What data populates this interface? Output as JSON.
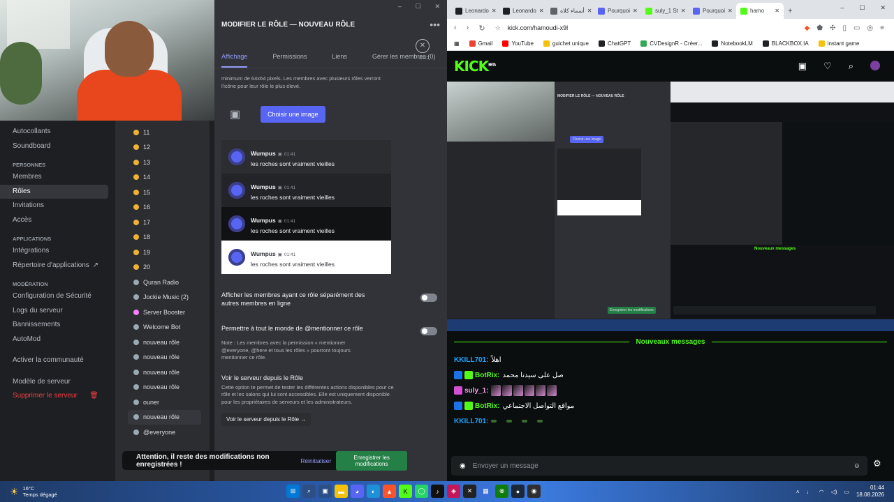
{
  "discord": {
    "window_controls": [
      "–",
      "☐",
      "✕"
    ],
    "editor": {
      "title": "MODIFIER LE RÔLE — NOUVEAU RÔLE",
      "more_label": "•••",
      "tabs": [
        "Affichage",
        "Permissions",
        "Liens",
        "Gérer les membres (0)"
      ],
      "close_label": "✕",
      "esc_label": "ESC",
      "icon_hint": "minimum de 64x64 pixels. Les membres avec plusieurs rôles verront l'icône pour leur rôle le plus élevé.",
      "choose_image": "Choisir une image",
      "previews": [
        {
          "name": "Wumpus",
          "time": "01:41",
          "text": "les roches sont vraiment vieilles"
        },
        {
          "name": "Wumpus",
          "time": "01:41",
          "text": "les roches sont vraiment vieilles"
        },
        {
          "name": "Wumpus",
          "time": "01:41",
          "text": "les roches sont vraiment vieilles"
        },
        {
          "name": "Wumpus",
          "time": "01:41",
          "text": "les roches sont vraiment vieilles"
        }
      ],
      "setting_separate": "Afficher les membres ayant ce rôle séparément des autres membres en ligne",
      "setting_mention": "Permettre à tout le monde de @mentionner ce rôle",
      "mention_note": "Note : Les membres avec la permission « mentionner @everyone, @here et tous les rôles » pourront toujours mentionner ce rôle.",
      "view_title": "Voir le serveur depuis le Rôle",
      "view_desc": "Cette option te permet de tester les différentes actions disponibles pour ce rôle et les salons qui lui sont accessibles. Elle est uniquement disponible pour les propriétaires de serveurs et les administrateurs.",
      "view_button": "Voir le serveur depuis le Rôle →"
    },
    "unsaved": {
      "message": "Attention, il reste des modifications non enregistrées !",
      "reset": "Réinitialiser",
      "save": "Enregistrer les modifications"
    },
    "nav": {
      "top_items": [
        "Autocollants",
        "Soundboard"
      ],
      "persons_head": "PERSONNES",
      "persons": [
        "Membres",
        "Rôles",
        "Invitations",
        "Accès"
      ],
      "apps_head": "APPLICATIONS",
      "apps": [
        "Intégrations",
        "Répertoire d'applications"
      ],
      "mod_head": "MODÉRATION",
      "mod": [
        "Configuration de Sécurité",
        "Logs du serveur",
        "Bannissements",
        "AutoMod"
      ],
      "community": "Activer la communauté",
      "template": "Modèle de serveur",
      "delete": "Supprimer le serveur",
      "external_icon": "↗",
      "trash_icon": "🗑"
    },
    "roles": [
      {
        "name": "11",
        "color": "#f0b232"
      },
      {
        "name": "12",
        "color": "#f0b232"
      },
      {
        "name": "13",
        "color": "#f0b232"
      },
      {
        "name": "14",
        "color": "#f0b232"
      },
      {
        "name": "15",
        "color": "#f0b232"
      },
      {
        "name": "16",
        "color": "#f0b232"
      },
      {
        "name": "17",
        "color": "#f0b232"
      },
      {
        "name": "18",
        "color": "#f0b232"
      },
      {
        "name": "19",
        "color": "#f0b232"
      },
      {
        "name": "20",
        "color": "#f0b232"
      },
      {
        "name": "Quran Radio",
        "color": "#99aab5"
      },
      {
        "name": "Jockie Music (2)",
        "color": "#99aab5"
      },
      {
        "name": "Server Booster",
        "color": "#f47fff"
      },
      {
        "name": "Welcome Bot",
        "color": "#99aab5"
      },
      {
        "name": "nouveau rôle",
        "color": "#99aab5"
      },
      {
        "name": "nouveau rôle",
        "color": "#99aab5"
      },
      {
        "name": "nouveau rôle",
        "color": "#99aab5"
      },
      {
        "name": "nouveau rôle",
        "color": "#99aab5"
      },
      {
        "name": "ouner",
        "color": "#99aab5"
      },
      {
        "name": "nouveau rôle",
        "color": "#99aab5"
      },
      {
        "name": "@everyone",
        "color": "#99aab5"
      }
    ]
  },
  "browser": {
    "tabs": [
      {
        "label": "Leonardo",
        "color": "#202124"
      },
      {
        "label": "Leonardo",
        "color": "#202124"
      },
      {
        "label": "أسماء كلاه",
        "color": "#5f6368"
      },
      {
        "label": "Pourquoi",
        "color": "#5865f2"
      },
      {
        "label": "suly_1 St",
        "color": "#53fc18"
      },
      {
        "label": "Pourquoi",
        "color": "#5865f2"
      },
      {
        "label": "hamo",
        "color": "#53fc18"
      }
    ],
    "new_tab": "+",
    "window_controls": [
      "–",
      "☐",
      "✕"
    ],
    "url": "kick.com/hamoudi-x9l",
    "nav_icons": [
      "‹",
      "›",
      "↻"
    ],
    "bookmarks": [
      {
        "label": "Gmail",
        "color": "#ea4335"
      },
      {
        "label": "YouTube",
        "color": "#ff0000"
      },
      {
        "label": "guichet unique",
        "color": "#f4c20d"
      },
      {
        "label": "ChatGPT",
        "color": "#202124"
      },
      {
        "label": "CVDesignR - Créer...",
        "color": "#34a853"
      },
      {
        "label": "NotebookLM",
        "color": "#202124"
      },
      {
        "label": "BLACKBOX.IA",
        "color": "#202124"
      },
      {
        "label": "instant game",
        "color": "#f4c20d"
      }
    ],
    "kick": {
      "logo": "KICK",
      "logo_sup": "BETA",
      "new_messages": "Nouveaux messages",
      "messages": [
        {
          "user": "KKILL701:",
          "user_color": "#1ba5ff",
          "text": "اهلاً",
          "badges": []
        },
        {
          "user": "BotRix:",
          "user_color": "#53fc18",
          "text": "صل على سيدنا محمد",
          "badges": [
            "#1a73e8",
            "#53fc18"
          ]
        },
        {
          "user": "suly_1:",
          "user_color": "#ff9eef",
          "text": "",
          "badges": [
            "#d44fd4"
          ],
          "emotes": 6
        },
        {
          "user": "BotRix:",
          "user_color": "#53fc18",
          "text": "مواقع التواصل الاجتماعي",
          "badges": [
            "#1a73e8",
            "#53fc18"
          ]
        },
        {
          "user": "KKILL701:",
          "user_color": "#1ba5ff",
          "text": "",
          "badges": [],
          "green_emotes": 4
        }
      ],
      "input_placeholder": "Envoyer un message",
      "header_icons": [
        "▣",
        "♡",
        "⌕"
      ]
    },
    "stream_preview": {
      "title": "MODIFIER LE RÔLE — NOUVEAU RÔLE",
      "choose": "Choisir une image",
      "save": "Enregistrer les modifications",
      "new_messages": "Nouveaux messages"
    }
  },
  "taskbar": {
    "temp": "16°C",
    "weather": "Temps dégagé",
    "time": "01:44",
    "date": "18.08.2026"
  }
}
